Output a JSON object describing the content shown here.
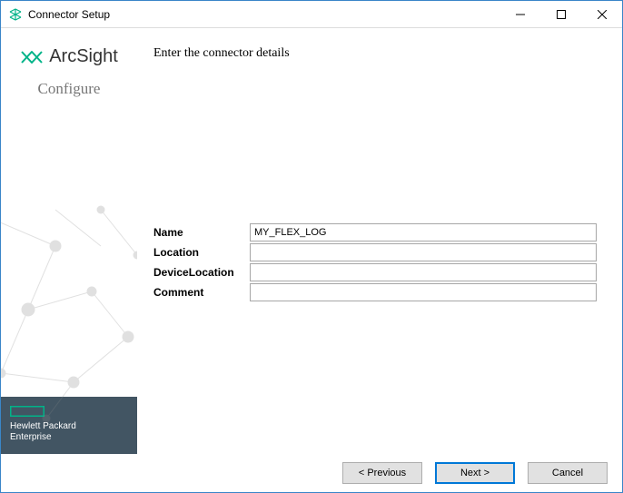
{
  "window": {
    "title": "Connector Setup"
  },
  "sidebar": {
    "brand": "ArcSight",
    "subtitle": "Configure",
    "vendor_line1": "Hewlett Packard",
    "vendor_line2": "Enterprise"
  },
  "main": {
    "instruction": "Enter the connector details",
    "fields": {
      "name": {
        "label": "Name",
        "value": "MY_FLEX_LOG"
      },
      "location": {
        "label": "Location",
        "value": ""
      },
      "device_location": {
        "label": "DeviceLocation",
        "value": ""
      },
      "comment": {
        "label": "Comment",
        "value": ""
      }
    }
  },
  "buttons": {
    "previous": "< Previous",
    "next": "Next >",
    "cancel": "Cancel"
  }
}
